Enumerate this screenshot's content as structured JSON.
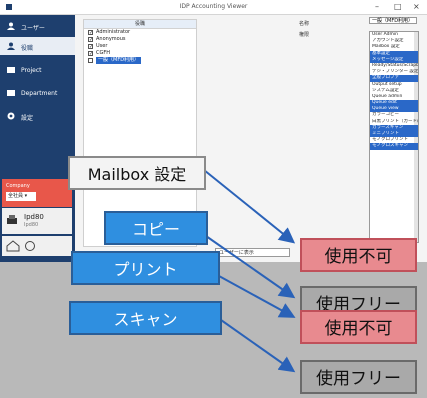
{
  "window": {
    "title": "IDP Accounting Viewer",
    "controls": [
      "–",
      "□",
      "×"
    ]
  },
  "sidebar": {
    "items": [
      {
        "label": "ユーザー",
        "icon": "user-icon"
      },
      {
        "label": "役職",
        "icon": "user-icon"
      },
      {
        "label": "Project",
        "icon": "folder-icon"
      },
      {
        "label": "Department",
        "icon": "folder-icon"
      },
      {
        "label": "設定",
        "icon": "gear-icon"
      }
    ],
    "company_label": "Company",
    "company_select": "全社員 ▾",
    "user_name": "Ipd80",
    "user_sub": "Ipd80",
    "colors": {
      "sidebar": "#1e3f6e",
      "company": "#e8574a"
    }
  },
  "roles": {
    "header": "役職",
    "rows": [
      {
        "label": "Administrator",
        "checked": true
      },
      {
        "label": "Anonymous",
        "checked": true
      },
      {
        "label": "User",
        "checked": true
      },
      {
        "label": "CGFH",
        "checked": true
      },
      {
        "label": "一般（MFD利用）",
        "checked": false,
        "selected": true
      }
    ]
  },
  "form": {
    "label_name": "名称",
    "label_perm": "権限"
  },
  "perm_select": "一般（MFD利用）",
  "permissions": [
    {
      "label": "User Admin",
      "sel": false
    },
    {
      "label": "アカウント設定",
      "sel": false
    },
    {
      "label": "Mailbox 設定",
      "sel": false
    },
    {
      "label": "基本設定",
      "sel": true
    },
    {
      "label": "メッセージ設定",
      "sel": true
    },
    {
      "label": "Ready/Status/Scrapbit 設定",
      "sel": false
    },
    {
      "label": "デジ・プリンター 設定",
      "sel": false
    },
    {
      "label": "全般プロファ",
      "sel": true
    },
    {
      "label": "Output setup",
      "sel": false
    },
    {
      "label": "システム設定",
      "sel": false
    },
    {
      "label": "Queue admin",
      "sel": false
    },
    {
      "label": "Queue edit",
      "sel": true
    },
    {
      "label": "Queue view",
      "sel": true
    },
    {
      "label": "カラーコピー",
      "sel": false
    },
    {
      "label": "白黒プリント（カード/タイムス）",
      "sel": false
    },
    {
      "label": "カラースキャン",
      "sel": true
    },
    {
      "label": "ミニプリント",
      "sel": true
    },
    {
      "label": "モノクロプリント",
      "sel": false
    },
    {
      "label": "モノクロスキャン",
      "sel": true
    },
    {
      "label": "",
      "sel": false
    }
  ],
  "bottom_field": "ユーザーに表示",
  "callouts": {
    "left": [
      "Mailbox 設定",
      "コピー",
      "プリント",
      "スキャン"
    ],
    "right": [
      "使用不可",
      "使用フリー",
      "使用不可",
      "使用フリー"
    ],
    "colors": {
      "blue": "#2f8fe0",
      "red": "#e88a8f",
      "gray": "#a9a9a9",
      "arrow": "#2a62b8"
    }
  }
}
